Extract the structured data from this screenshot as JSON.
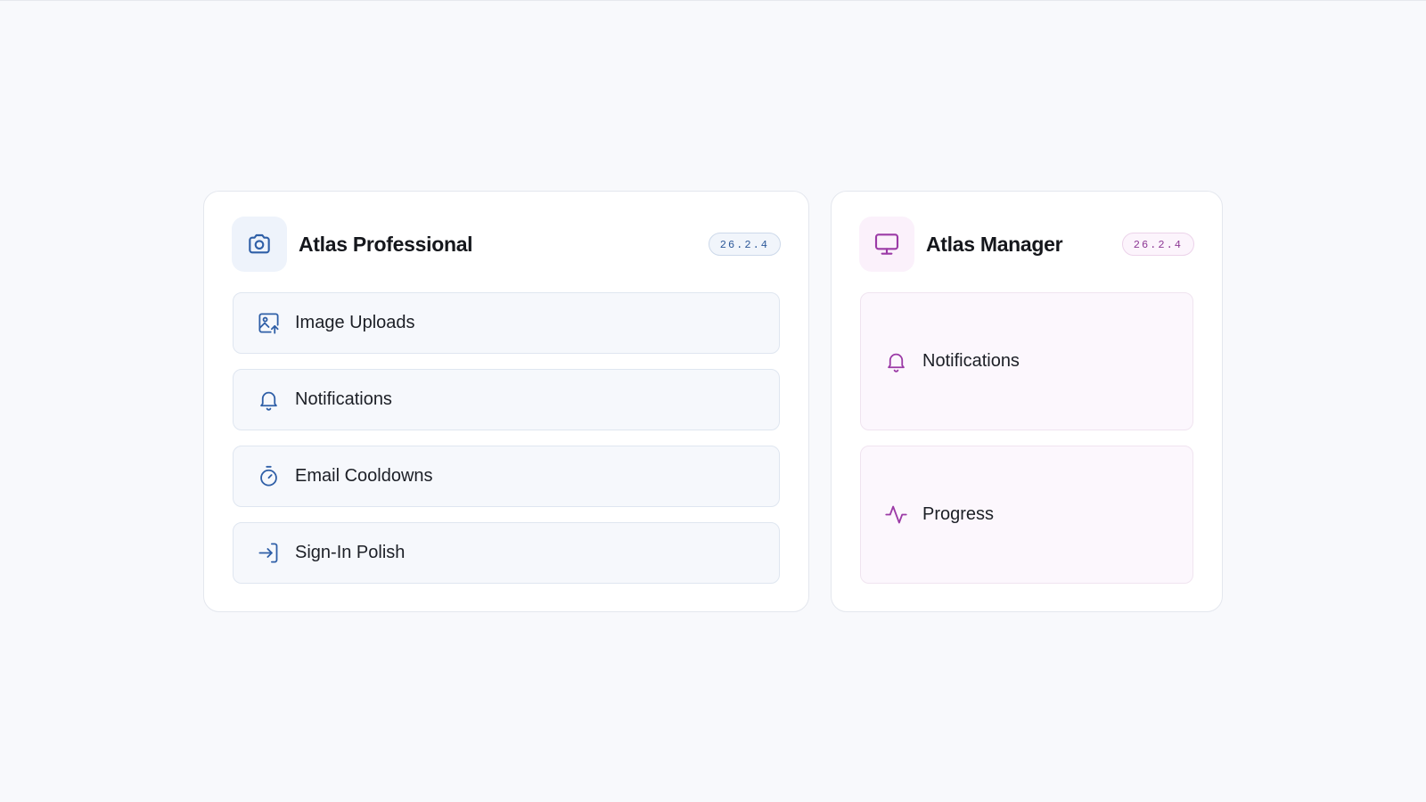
{
  "colors": {
    "professional_accent": "#2f5fa7",
    "manager_accent": "#9b3aa6",
    "background": "#f8f9fc"
  },
  "professional": {
    "title": "Atlas Professional",
    "version": "26.2.4",
    "icon": "camera-icon",
    "items": [
      {
        "label": "Image Uploads",
        "icon": "image-upload-icon"
      },
      {
        "label": "Notifications",
        "icon": "bell-icon"
      },
      {
        "label": "Email Cooldowns",
        "icon": "timer-icon"
      },
      {
        "label": "Sign-In Polish",
        "icon": "sign-in-icon"
      }
    ]
  },
  "manager": {
    "title": "Atlas Manager",
    "version": "26.2.4",
    "icon": "monitor-icon",
    "items": [
      {
        "label": "Notifications",
        "icon": "bell-icon"
      },
      {
        "label": "Progress",
        "icon": "activity-icon"
      }
    ]
  }
}
